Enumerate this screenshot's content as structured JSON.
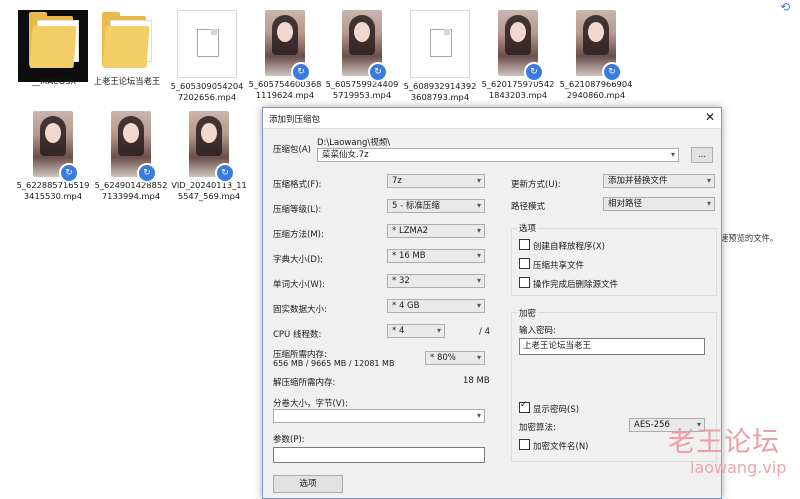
{
  "files": [
    {
      "name": "__MACOSX",
      "kind": "folder"
    },
    {
      "name": "上老王论坛当老王",
      "kind": "folder"
    },
    {
      "name": "5_6053090542047202656.mp4",
      "kind": "doc"
    },
    {
      "name": "5_6057546003681119624.mp4",
      "kind": "photo"
    },
    {
      "name": "5_6057599244095719953.mp4",
      "kind": "photo"
    },
    {
      "name": "5_6089329143923608793.mp4",
      "kind": "doc"
    },
    {
      "name": "5_6201759705421843203.mp4",
      "kind": "photo"
    },
    {
      "name": "5_6210879669042940860.mp4",
      "kind": "photo"
    },
    {
      "name": "5_6228857165193415530.mp4",
      "kind": "photo"
    },
    {
      "name": "5_6249014288527133994.mp4",
      "kind": "photo"
    },
    {
      "name": "VID_20240113_115547_569.mp4",
      "kind": "photo"
    }
  ],
  "side_text": "速预览的文件。",
  "dialog": {
    "title": "添加到压缩包",
    "close": "✕",
    "archive_label": "压缩包(A)",
    "archive_path": "D:\\Laowang\\视频\\",
    "archive_name": "菜菜仙女.7z",
    "browse": "...",
    "format_label": "压缩格式(F):",
    "format_value": "7z",
    "level_label": "压缩等级(L):",
    "level_value": "5 - 标准压缩",
    "method_label": "压缩方法(M):",
    "method_value": "* LZMA2",
    "dict_label": "字典大小(D):",
    "dict_value": "* 16 MB",
    "word_label": "单词大小(W):",
    "word_value": "* 32",
    "solid_label": "固实数据大小:",
    "solid_value": "* 4 GB",
    "cpu_label": "CPU 线程数:",
    "cpu_value": "* 4",
    "cpu_total": "/ 4",
    "mem_label": "压缩所需内存:",
    "mem_value": "656 MB / 9665 MB / 12081 MB",
    "mem_pct": "* 80%",
    "decomp_label": "解压缩所需内存:",
    "decomp_value": "18 MB",
    "split_label": "分卷大小，字节(V):",
    "params_label": "参数(P):",
    "options_btn": "选项",
    "update_label": "更新方式(U):",
    "update_value": "添加并替换文件",
    "path_label": "路径模式",
    "path_value": "相对路径",
    "options_group": "选项",
    "opt_sfx": "创建自释放程序(X)",
    "opt_shared": "压缩共享文件",
    "opt_delete": "操作完成后删除源文件",
    "encrypt_group": "加密",
    "pwd_label": "输入密码:",
    "pwd_value": "上老王论坛当老王",
    "show_pwd": "显示密码(S)",
    "enc_method_label": "加密算法:",
    "enc_method_value": "AES-256",
    "enc_names": "加密文件名(N)"
  },
  "watermark": {
    "line1": "老王论坛",
    "line2": "laowang.vip"
  }
}
